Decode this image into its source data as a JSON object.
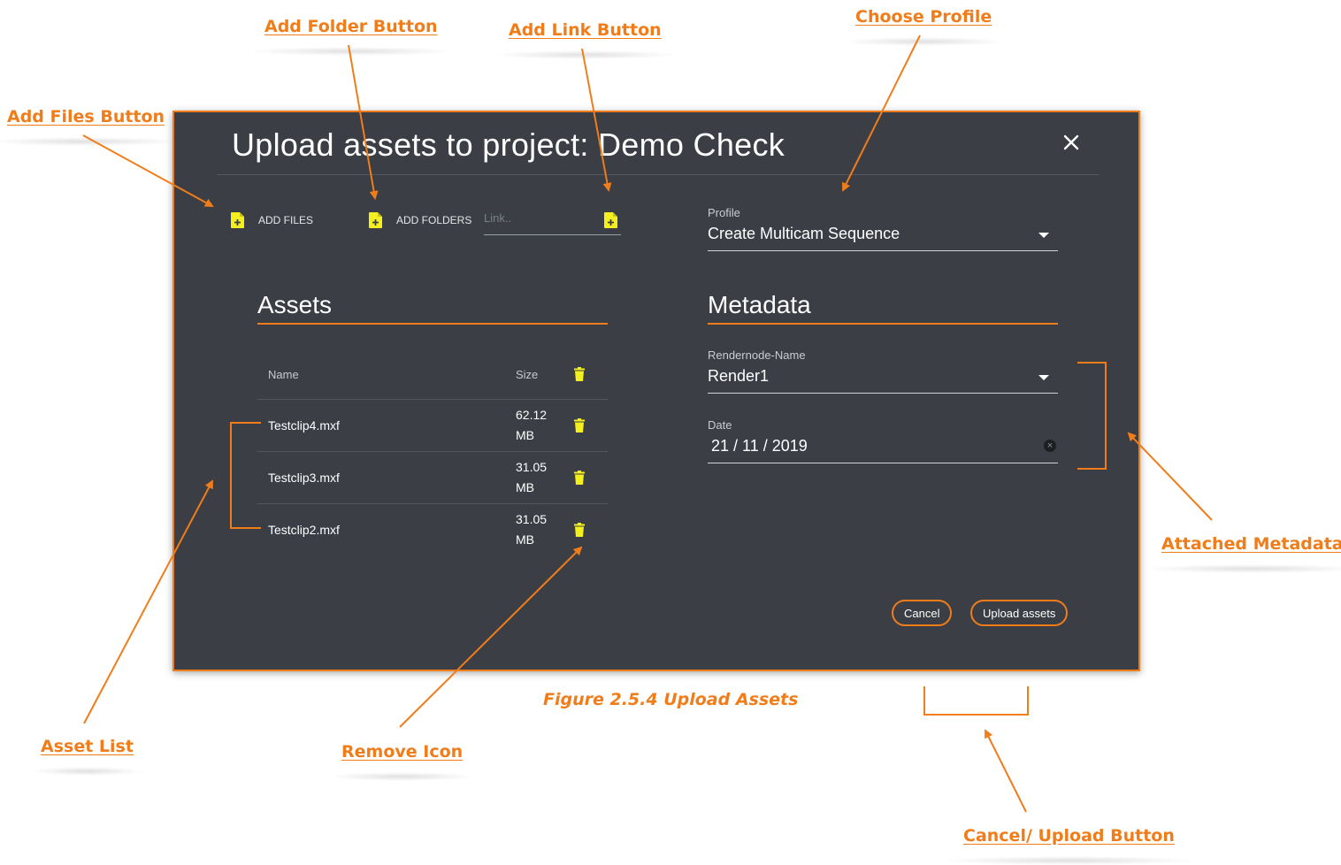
{
  "dialog": {
    "title": "Upload assets to project: Demo Check",
    "toolbar": {
      "add_files_label": "ADD FILES",
      "add_folders_label": "ADD FOLDERS",
      "link_placeholder": "Link.."
    },
    "profile": {
      "label": "Profile",
      "value": "Create Multicam Sequence"
    },
    "assets": {
      "heading": "Assets",
      "columns": {
        "name": "Name",
        "size": "Size"
      },
      "rows": [
        {
          "name": "Testclip4.mxf",
          "size_value": "62.12",
          "size_unit": "MB"
        },
        {
          "name": "Testclip3.mxf",
          "size_value": "31.05",
          "size_unit": "MB"
        },
        {
          "name": "Testclip2.mxf",
          "size_value": "31.05",
          "size_unit": "MB"
        }
      ]
    },
    "metadata": {
      "heading": "Metadata",
      "rendernode": {
        "label": "Rendernode-Name",
        "value": "Render1"
      },
      "date": {
        "label": "Date",
        "value": "21 / 11 / 2019"
      }
    },
    "buttons": {
      "cancel": "Cancel",
      "upload": "Upload assets"
    }
  },
  "callouts": {
    "add_files": "Add Files Button",
    "add_folder": "Add Folder Button",
    "add_link": "Add Link Button",
    "choose_profile": "Choose Profile",
    "attached_metadata": "Attached Metadata",
    "asset_list": "Asset List",
    "remove_icon": "Remove Icon",
    "cancel_upload": "Cancel/ Upload Button"
  },
  "caption": "Figure 2.5.4 Upload Assets",
  "colors": {
    "accent": "#f07d1a",
    "icon": "#f4ef1f",
    "dialog_bg": "#3b3e45"
  }
}
